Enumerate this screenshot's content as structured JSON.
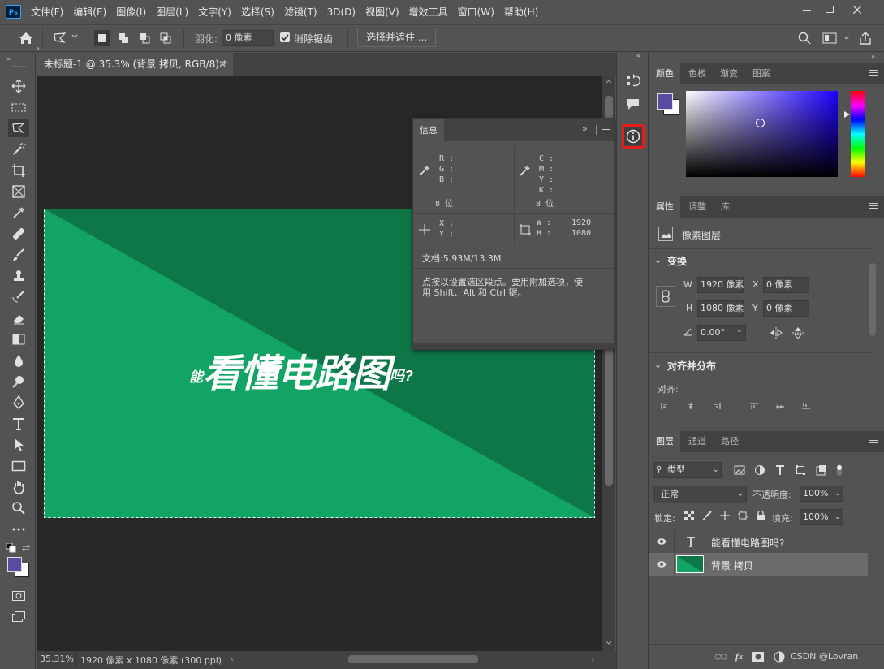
{
  "app": {
    "logo": "Ps"
  },
  "menu": [
    "文件(F)",
    "编辑(E)",
    "图像(I)",
    "图层(L)",
    "文字(Y)",
    "选择(S)",
    "滤镜(T)",
    "3D(D)",
    "视图(V)",
    "增效工具",
    "窗口(W)",
    "帮助(H)"
  ],
  "options": {
    "feather_label": "羽化:",
    "feather_value": "0 像素",
    "antialias_label": "消除锯齿",
    "select_mask_button": "选择并遮住 ..."
  },
  "document": {
    "tab_title": "未标题-1 @ 35.3% (背景 拷贝, RGB/8) *",
    "canvas_text_small_prefix": "能",
    "canvas_text_big": "看懂电路图",
    "canvas_text_small_suffix": "吗?",
    "colors": {
      "light_green": "#12a464",
      "dark_green": "#0e7748"
    }
  },
  "status": {
    "zoom": "35.31%",
    "doc_size": "1920 像素 x 1080 像素 (300 ppi)"
  },
  "info_panel": {
    "tab": "信息",
    "rgb_labels": "R :\nG :\nB :",
    "cmyk_labels": "C :\nM :\nY :\nK :",
    "bit_depth_left": "8 位",
    "bit_depth_right": "8 位",
    "xy_labels": "X :\nY :",
    "w_label": "W :",
    "h_label": "H :",
    "w_value": "1920",
    "h_value": "1080",
    "doc_info": "文档:5.93M/13.3M",
    "hint_line1": "点按以设置选区段点。要用附加选项，使",
    "hint_line2": "用 Shift、Alt 和 Ctrl 键。"
  },
  "color_panel": {
    "tabs": [
      "颜色",
      "色板",
      "渐变",
      "图案"
    ],
    "foreground": "#5a4aa0",
    "background": "#ffffff"
  },
  "properties_panel": {
    "tabs": [
      "属性",
      "调整",
      "库"
    ],
    "layer_type": "像素图层",
    "transform_title": "变换",
    "w_label": "W",
    "h_label": "H",
    "x_label": "X",
    "y_label": "Y",
    "w_value": "1920 像素",
    "h_value": "1080 像素",
    "x_value": "0 像素",
    "y_value": "0 像素",
    "angle_value": "0.00°",
    "align_title": "对齐并分布",
    "align_label": "对齐:"
  },
  "layers_panel": {
    "tabs": [
      "图层",
      "通道",
      "路径"
    ],
    "filter_label": "类型",
    "blend_mode": "正常",
    "opacity_label": "不透明度:",
    "opacity_value": "100%",
    "lock_label": "锁定:",
    "fill_label": "填充:",
    "fill_value": "100%",
    "layers": [
      {
        "name": "能看懂电路图吗?",
        "type": "text"
      },
      {
        "name": "背景 拷贝",
        "type": "pixel"
      }
    ],
    "watermark": "CSDN @Lovran"
  }
}
